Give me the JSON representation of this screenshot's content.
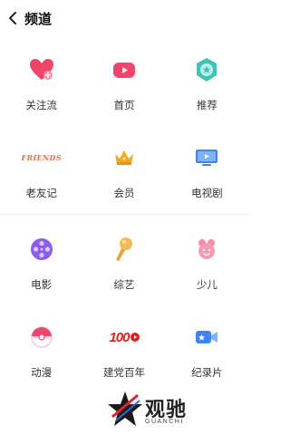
{
  "header": {
    "title": "频道"
  },
  "channels": [
    {
      "label": "关注流",
      "icon": "heart-plus-icon"
    },
    {
      "label": "首页",
      "icon": "home-play-icon"
    },
    {
      "label": "推荐",
      "icon": "recommend-star-icon"
    },
    {
      "label": "老友记",
      "icon": "friends-logo-icon",
      "icon_text": "FRIENDS"
    },
    {
      "label": "会员",
      "icon": "crown-icon"
    },
    {
      "label": "电视剧",
      "icon": "tv-icon"
    },
    {
      "label": "电影",
      "icon": "film-reel-icon"
    },
    {
      "label": "综艺",
      "icon": "microphone-icon"
    },
    {
      "label": "少儿",
      "icon": "child-face-icon"
    },
    {
      "label": "动漫",
      "icon": "pokeball-icon"
    },
    {
      "label": "建党百年",
      "icon": "centenary-100-icon",
      "icon_text": "100"
    },
    {
      "label": "纪录片",
      "icon": "camera-icon"
    }
  ],
  "watermark": {
    "text": "观驰",
    "sub": "GUANCHI"
  },
  "colors": {
    "accent": "#f0456b",
    "teal": "#3ec6b4",
    "orange": "#f5a623",
    "blue": "#3b86f0",
    "purple": "#8a5cf0"
  }
}
